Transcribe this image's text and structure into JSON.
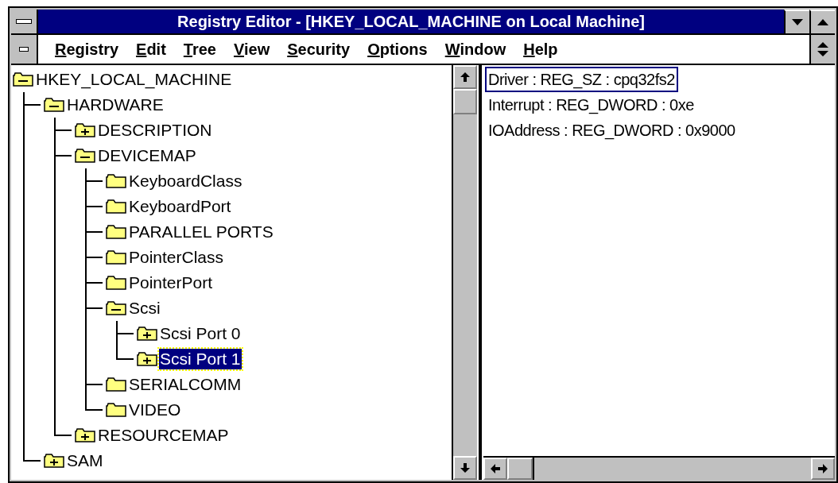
{
  "window": {
    "title": "Registry Editor - [HKEY_LOCAL_MACHINE on Local Machine]"
  },
  "menu": [
    "Registry",
    "Edit",
    "Tree",
    "View",
    "Security",
    "Options",
    "Window",
    "Help"
  ],
  "tree": [
    {
      "label": "HKEY_LOCAL_MACHINE",
      "kind": "expanded",
      "selected": false,
      "children": [
        {
          "label": "HARDWARE",
          "kind": "expanded",
          "selected": false,
          "children": [
            {
              "label": "DESCRIPTION",
              "kind": "collapsed",
              "selected": false
            },
            {
              "label": "DEVICEMAP",
              "kind": "expanded",
              "selected": false,
              "children": [
                {
                  "label": "KeyboardClass",
                  "kind": "leaf",
                  "selected": false
                },
                {
                  "label": "KeyboardPort",
                  "kind": "leaf",
                  "selected": false
                },
                {
                  "label": "PARALLEL PORTS",
                  "kind": "leaf",
                  "selected": false
                },
                {
                  "label": "PointerClass",
                  "kind": "leaf",
                  "selected": false
                },
                {
                  "label": "PointerPort",
                  "kind": "leaf",
                  "selected": false
                },
                {
                  "label": "Scsi",
                  "kind": "expanded",
                  "selected": false,
                  "children": [
                    {
                      "label": "Scsi Port 0",
                      "kind": "collapsed",
                      "selected": false
                    },
                    {
                      "label": "Scsi Port 1",
                      "kind": "collapsed",
                      "selected": true
                    }
                  ]
                },
                {
                  "label": "SERIALCOMM",
                  "kind": "leaf",
                  "selected": false
                },
                {
                  "label": "VIDEO",
                  "kind": "leaf",
                  "selected": false
                }
              ]
            },
            {
              "label": "RESOURCEMAP",
              "kind": "collapsed",
              "selected": false
            }
          ]
        },
        {
          "label": "SAM",
          "kind": "collapsed",
          "selected": false
        }
      ]
    }
  ],
  "values": [
    {
      "text": "Driver : REG_SZ : cpq32fs2",
      "selected": true
    },
    {
      "text": "Interrupt : REG_DWORD : 0xe",
      "selected": false
    },
    {
      "text": "IOAddress : REG_DWORD : 0x9000",
      "selected": false
    }
  ]
}
